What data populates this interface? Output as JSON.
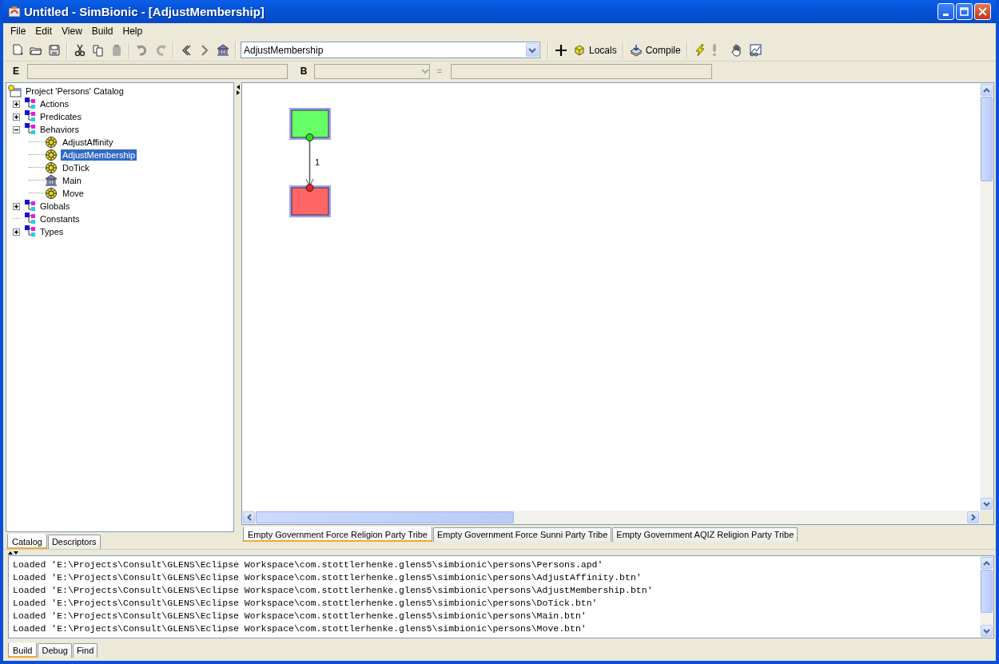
{
  "window": {
    "title": "Untitled - SimBionic - [AdjustMembership]"
  },
  "menu": [
    "File",
    "Edit",
    "View",
    "Build",
    "Help"
  ],
  "toolbar": {
    "groups": [
      [
        {
          "kind": "new",
          "disabled": false
        },
        {
          "kind": "open",
          "disabled": false
        },
        {
          "kind": "save",
          "disabled": false
        }
      ],
      [
        {
          "kind": "cut",
          "disabled": false
        },
        {
          "kind": "copy",
          "disabled": false
        },
        {
          "kind": "paste",
          "disabled": true
        }
      ],
      [
        {
          "kind": "undo",
          "disabled": true
        },
        {
          "kind": "redo",
          "disabled": true
        }
      ],
      [
        {
          "kind": "back",
          "disabled": false
        },
        {
          "kind": "forward",
          "disabled": true
        },
        {
          "kind": "home",
          "disabled": false
        }
      ]
    ],
    "behavior_select": {
      "value": "AdjustMembership"
    },
    "after_groups": [
      [
        {
          "kind": "add",
          "disabled": false
        },
        {
          "kind": "locals",
          "label": "Locals",
          "disabled": false
        }
      ],
      [
        {
          "kind": "compile",
          "label": "Compile",
          "disabled": false
        }
      ],
      [
        {
          "kind": "run",
          "disabled": false
        },
        {
          "kind": "alert",
          "disabled": true
        },
        {
          "kind": "pause",
          "disabled": false
        },
        {
          "kind": "chart",
          "disabled": false
        }
      ]
    ]
  },
  "expression_bar": {
    "expression_label": "E",
    "binding_label": "B",
    "equals": "="
  },
  "catalog": {
    "root": {
      "label": "Project 'Persons' Catalog",
      "selected": false,
      "children": [
        {
          "label": "Actions",
          "kind": "folder",
          "expanded": false,
          "selected": false
        },
        {
          "label": "Predicates",
          "kind": "folder",
          "expanded": false,
          "selected": false
        },
        {
          "label": "Behaviors",
          "kind": "folder",
          "expanded": true,
          "selected": false,
          "children": [
            {
              "label": "AdjustAffinity",
              "kind": "behavior",
              "selected": false
            },
            {
              "label": "AdjustMembership",
              "kind": "behavior",
              "selected": true
            },
            {
              "label": "DoTick",
              "kind": "behavior",
              "selected": false
            },
            {
              "label": "Main",
              "kind": "main",
              "selected": false
            },
            {
              "label": "Move",
              "kind": "behavior",
              "selected": false
            }
          ]
        },
        {
          "label": "Globals",
          "kind": "folder",
          "expanded": false,
          "selected": false
        },
        {
          "label": "Constants",
          "kind": "folder",
          "selected": false
        },
        {
          "label": "Types",
          "kind": "folder",
          "expanded": false,
          "selected": false
        }
      ]
    }
  },
  "left_tabs": [
    {
      "label": "Catalog",
      "selected": true
    },
    {
      "label": "Descriptors",
      "selected": false
    }
  ],
  "canvas": {
    "nodes": [
      {
        "kind": "initial"
      },
      {
        "kind": "final"
      }
    ],
    "connectors": [
      {
        "label": "1"
      }
    ]
  },
  "canvas_tabs": [
    {
      "label": "Empty Government Force Religion Party Tribe",
      "selected": true
    },
    {
      "label": "Empty Government Force Sunni Party Tribe",
      "selected": false
    },
    {
      "label": "Empty Government AQIZ Religion Party Tribe",
      "selected": false
    }
  ],
  "output": {
    "lines": [
      "Loaded 'E:\\Projects\\Consult\\GLENS\\Eclipse Workspace\\com.stottlerhenke.glens5\\simbionic\\persons\\Persons.apd'",
      "Loaded 'E:\\Projects\\Consult\\GLENS\\Eclipse Workspace\\com.stottlerhenke.glens5\\simbionic\\persons\\AdjustAffinity.btn'",
      "Loaded 'E:\\Projects\\Consult\\GLENS\\Eclipse Workspace\\com.stottlerhenke.glens5\\simbionic\\persons\\AdjustMembership.btn'",
      "Loaded 'E:\\Projects\\Consult\\GLENS\\Eclipse Workspace\\com.stottlerhenke.glens5\\simbionic\\persons\\DoTick.btn'",
      "Loaded 'E:\\Projects\\Consult\\GLENS\\Eclipse Workspace\\com.stottlerhenke.glens5\\simbionic\\persons\\Main.btn'",
      "Loaded 'E:\\Projects\\Consult\\GLENS\\Eclipse Workspace\\com.stottlerhenke.glens5\\simbionic\\persons\\Move.btn'"
    ]
  },
  "bottom_tabs": [
    {
      "label": "Build",
      "selected": true
    },
    {
      "label": "Debug",
      "selected": false
    },
    {
      "label": "Find",
      "selected": false
    }
  ]
}
